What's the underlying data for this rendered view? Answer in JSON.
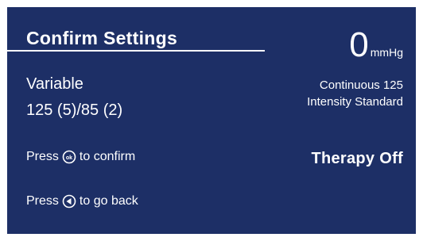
{
  "header": {
    "title": "Confirm Settings"
  },
  "settings": {
    "mode": "Variable",
    "values": "125 (5)/85 (2)"
  },
  "instructions": {
    "confirm_prefix": "Press",
    "confirm_suffix": "to confirm",
    "back_prefix": "Press",
    "back_suffix": "to go back",
    "confirm_icon": "ok-button-icon",
    "back_icon": "back-arrow-button-icon"
  },
  "status_panel": {
    "pressure_value": "0",
    "pressure_unit": "mmHg",
    "line1": "Continuous 125",
    "line2": "Intensity Standard",
    "therapy_status": "Therapy Off"
  },
  "colors": {
    "background": "#1d2f66",
    "foreground": "#ffffff"
  }
}
